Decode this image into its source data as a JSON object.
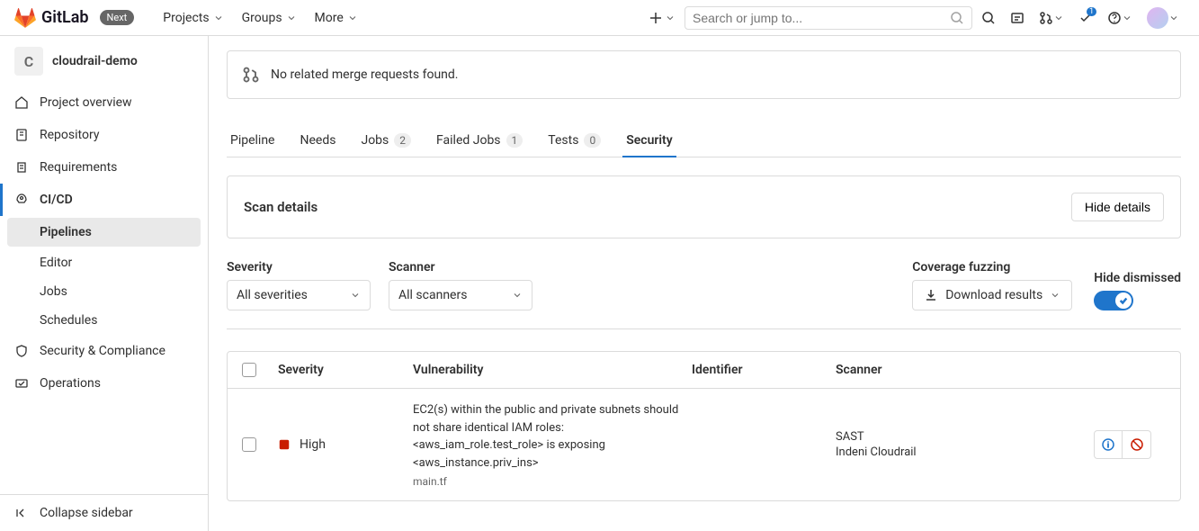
{
  "header": {
    "logo_text": "GitLab",
    "next_badge": "Next",
    "nav": {
      "projects": "Projects",
      "groups": "Groups",
      "more": "More"
    },
    "search_placeholder": "Search or jump to...",
    "todos_count": "1"
  },
  "sidebar": {
    "project_avatar_letter": "C",
    "project_name": "cloudrail-demo",
    "items": {
      "overview": "Project overview",
      "repository": "Repository",
      "requirements": "Requirements",
      "cicd": "CI/CD",
      "security_compliance": "Security & Compliance",
      "operations": "Operations"
    },
    "cicd_sub": {
      "pipelines": "Pipelines",
      "editor": "Editor",
      "jobs": "Jobs",
      "schedules": "Schedules"
    },
    "collapse": "Collapse sidebar"
  },
  "mr_banner": "No related merge requests found.",
  "tabs": {
    "pipeline": "Pipeline",
    "needs": "Needs",
    "jobs": "Jobs",
    "jobs_count": "2",
    "failed_jobs": "Failed Jobs",
    "failed_jobs_count": "1",
    "tests": "Tests",
    "tests_count": "0",
    "security": "Security"
  },
  "scan_details": {
    "title": "Scan details",
    "hide_button": "Hide details"
  },
  "filters": {
    "severity_label": "Severity",
    "severity_value": "All severities",
    "scanner_label": "Scanner",
    "scanner_value": "All scanners",
    "coverage_label": "Coverage fuzzing",
    "download_label": "Download results",
    "hide_dismissed_label": "Hide dismissed"
  },
  "table": {
    "headers": {
      "severity": "Severity",
      "vulnerability": "Vulnerability",
      "identifier": "Identifier",
      "scanner": "Scanner"
    },
    "rows": [
      {
        "severity": "High",
        "vulnerability_text": "EC2(s) within the public and private subnets should not share identical IAM roles: <aws_iam_role.test_role> is exposing <aws_instance.priv_ins>",
        "vulnerability_file": "main.tf",
        "scanner_name": "SAST",
        "scanner_vendor": "Indeni Cloudrail"
      }
    ]
  },
  "colors": {
    "primary": "#1f75cb",
    "severity_high": "#c91c00"
  }
}
